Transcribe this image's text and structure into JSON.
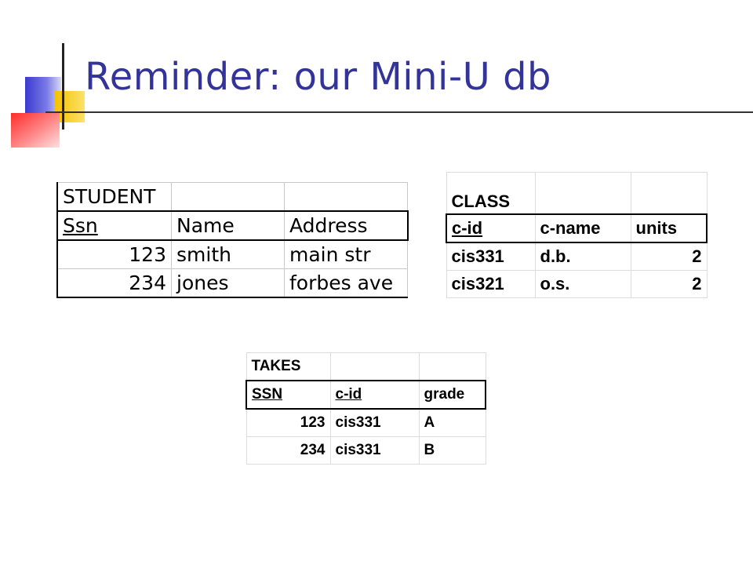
{
  "slide": {
    "title": "Reminder: our Mini-U db"
  },
  "student": {
    "name": "STUDENT",
    "columns": [
      "Ssn",
      "Name",
      "Address"
    ],
    "rows": [
      [
        "123",
        "smith",
        "main str"
      ],
      [
        "234",
        "jones",
        "forbes ave"
      ]
    ]
  },
  "class": {
    "name": "CLASS",
    "columns": [
      "c-id",
      "c-name",
      "units"
    ],
    "rows": [
      [
        "cis331",
        "d.b.",
        "2"
      ],
      [
        "cis321",
        "o.s.",
        "2"
      ]
    ]
  },
  "takes": {
    "name": "TAKES",
    "columns": [
      "SSN",
      "c-id",
      "grade"
    ],
    "rows": [
      [
        "123",
        "cis331",
        "A"
      ],
      [
        "234",
        "cis331",
        "B"
      ]
    ]
  }
}
